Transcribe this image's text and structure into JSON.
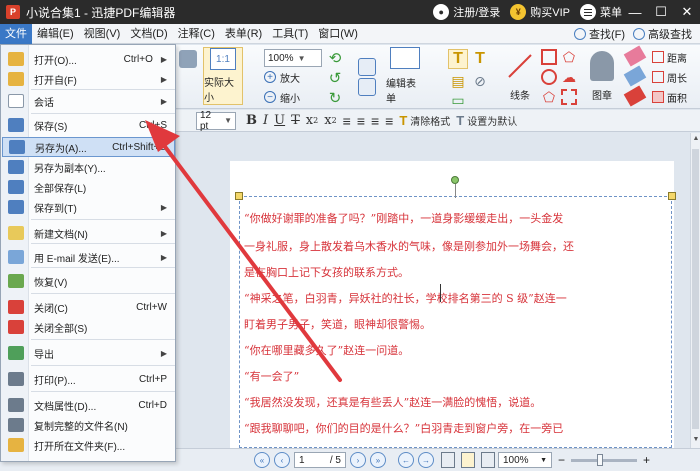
{
  "titlebar": {
    "title": "小说合集1 - 迅捷PDF编辑器",
    "login": "注册/登录",
    "vip": "购买VIP",
    "menu": "菜单",
    "minimize": "—",
    "maximize": "☐",
    "close": "✕"
  },
  "menubar": {
    "items": [
      "文件",
      "编辑(E)",
      "视图(V)",
      "文档(D)",
      "注释(C)",
      "表单(R)",
      "工具(T)",
      "窗口(W)"
    ],
    "find": "查找(F)",
    "advanced_find": "高级查找"
  },
  "ribbon": {
    "zoom_value": "100%",
    "actual_size": "实际大小",
    "zoom_in": "放大",
    "zoom_out": "缩小",
    "edit_form": "编辑表单",
    "line": "线条",
    "stamp": "图章",
    "distance": "距离",
    "perimeter": "周长",
    "area": "面积",
    "font_size": "12 pt",
    "clear_format": "清除格式",
    "set_default": "设置为默认"
  },
  "file_menu": {
    "items": [
      {
        "label": "打开(O)...",
        "shortcut": "Ctrl+O",
        "submenu": true,
        "icon": "open-folder-icon",
        "color": "#e6b341"
      },
      {
        "label": "打开自(F)",
        "shortcut": "",
        "submenu": true,
        "icon": "open-from-icon",
        "color": "#e6b341"
      },
      {
        "label": "会话",
        "shortcut": "",
        "submenu": true,
        "icon": "session-icon",
        "color": "#ffffff"
      },
      {
        "label": "保存(S)",
        "shortcut": "Ctrl+S",
        "submenu": false,
        "icon": "save-icon",
        "color": "#4f7fbf"
      },
      {
        "label": "另存为(A)...",
        "shortcut": "Ctrl+Shift+S",
        "submenu": false,
        "icon": "save-as-icon",
        "color": "#4f7fbf"
      },
      {
        "label": "另存为副本(Y)...",
        "shortcut": "",
        "submenu": false,
        "icon": "save-copy-icon",
        "color": "#4f7fbf"
      },
      {
        "label": "全部保存(L)",
        "shortcut": "",
        "submenu": false,
        "icon": "save-all-icon",
        "color": "#4f7fbf"
      },
      {
        "label": "保存到(T)",
        "shortcut": "",
        "submenu": true,
        "icon": "save-to-icon",
        "color": "#4f7fbf"
      },
      {
        "label": "新建文档(N)",
        "shortcut": "",
        "submenu": true,
        "icon": "new-document-icon",
        "color": "#e8c95a"
      },
      {
        "label": "用 E-mail 发送(E)...",
        "shortcut": "",
        "submenu": true,
        "icon": "email-icon",
        "color": "#7aa6d8"
      },
      {
        "label": "恢复(V)",
        "shortcut": "",
        "submenu": false,
        "icon": "restore-icon",
        "color": "#6aa84f"
      },
      {
        "label": "关闭(C)",
        "shortcut": "Ctrl+W",
        "submenu": false,
        "icon": "close-doc-icon",
        "color": "#d9413a"
      },
      {
        "label": "关闭全部(S)",
        "shortcut": "",
        "submenu": false,
        "icon": "close-all-icon",
        "color": "#d9413a"
      },
      {
        "label": "导出",
        "shortcut": "",
        "submenu": true,
        "icon": "export-icon",
        "color": "#4f9f5a"
      },
      {
        "label": "打印(P)...",
        "shortcut": "Ctrl+P",
        "submenu": false,
        "icon": "print-icon",
        "color": "#6c7b8c"
      },
      {
        "label": "文档属性(D)...",
        "shortcut": "Ctrl+D",
        "submenu": false,
        "icon": "doc-properties-icon",
        "color": "#6c7b8c"
      },
      {
        "label": "复制完整的文件名(N)",
        "shortcut": "",
        "submenu": false,
        "icon": "copy-filename-icon",
        "color": "#6c7b8c"
      },
      {
        "label": "打开所在文件夹(F)...",
        "shortcut": "",
        "submenu": false,
        "icon": "open-containing-folder-icon",
        "color": "#e6b341"
      }
    ]
  },
  "document": {
    "lines": [
      "“你做好谢罪的准备了吗？”刚踏中，一道身影缓缓走出，一头金发",
      "一身礼服，身上散发着乌木香水的气味，像是刚参加外一场舞会，还",
      "是在胸口上记下女孩的联系方式。",
      "“神采之笔，白羽青，异妖社的社长，学校排名第三的 S 级”赵连一",
      "盯着男子男子，笑道，眼神却很警惕。",
      "“你在哪里藏多久了”赵连一问道。",
      "“有一会了”",
      "“我居然没发现，还真是有些丢人”赵连一满脸的愧悟，说道。",
      "“跟我聊聊吧，你们的目的是什么？”白羽青走到窗户旁，在一旁已"
    ]
  },
  "statusbar": {
    "page": "1",
    "page_total": "/ 5",
    "zoom": "100%"
  },
  "colors": {
    "accent": "#3a78c6",
    "text_red": "#d7333a",
    "arrow_red": "#e0393d"
  }
}
